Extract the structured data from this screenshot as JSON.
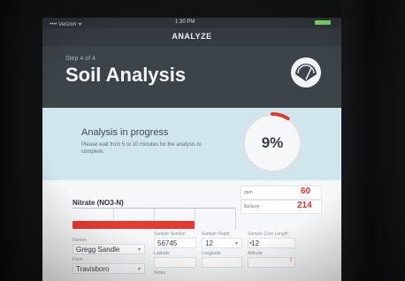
{
  "status_bar": {
    "carrier": "•••• Verizon ᯤ",
    "time": "1:30 PM",
    "battery_icon": "battery-icon"
  },
  "nav": {
    "title": "ANALYZE"
  },
  "header": {
    "step": "Step 4 of 4",
    "title": "Soil Analysis",
    "icon": "gauge-icon"
  },
  "progress": {
    "title": "Analysis in progress",
    "description": "Please wait from 5 to 10 minutes for the analysis to complete.",
    "percent_label": "9%",
    "percent_value": 0.09,
    "accent": "#e33a32"
  },
  "nutrient": {
    "label": "Nitrate (NO3-N)",
    "level": 0.6,
    "ppm_label": "ppm",
    "ppm_value": "60",
    "lbs_label": "lbs/acre",
    "lbs_value": "214"
  },
  "form": {
    "farmer_label": "Farmer",
    "farmer_value": "Gregg Sandle",
    "farm_label": "Farm",
    "farm_value": "Travisboro",
    "sample_label": "Sample Number",
    "sample_value": "56745",
    "depth_label": "Sample Depth",
    "depth_value": "12",
    "length_label": "Sample Core Length",
    "length_value": "12",
    "latitude_label": "Latitude",
    "longitude_label": "Longitude",
    "altitude_label": "Altitude",
    "notes_label": "Notes"
  }
}
